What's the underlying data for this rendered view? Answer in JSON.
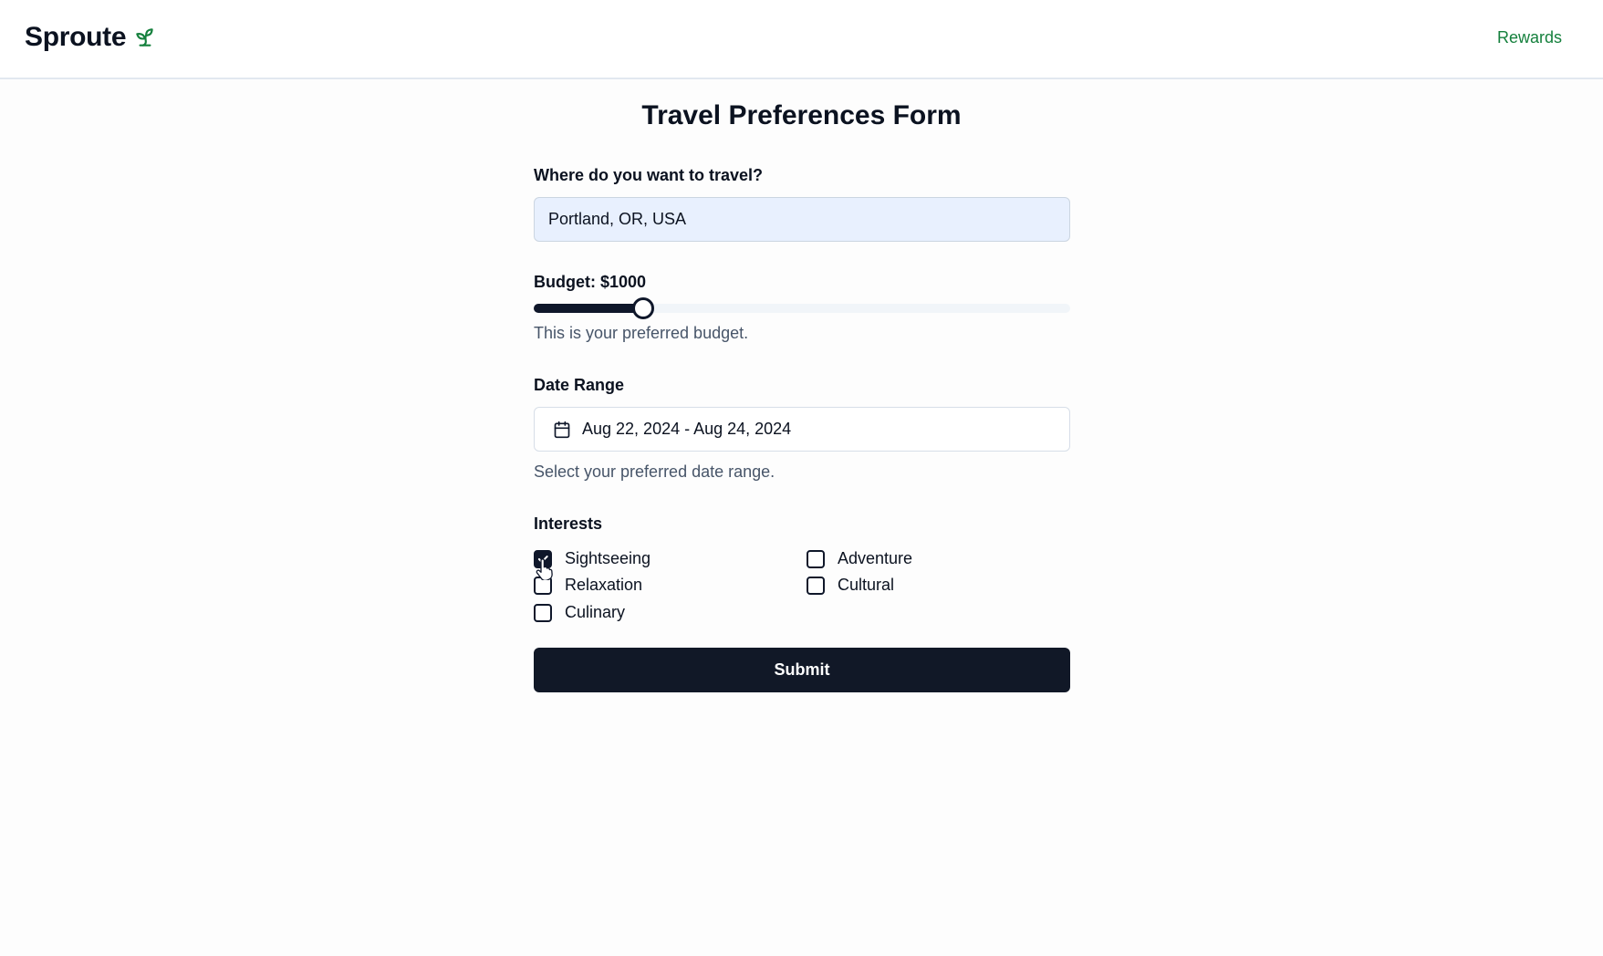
{
  "header": {
    "brand_name": "Sproute",
    "brand_icon": "sprout-icon",
    "nav_link": "Rewards",
    "accent_color": "#15803d"
  },
  "form": {
    "title": "Travel Preferences Form",
    "destination": {
      "label": "Where do you want to travel?",
      "value": "Portland, OR, USA"
    },
    "budget": {
      "label": "Budget: $1000",
      "fraction": 0.204,
      "helper": "This is your preferred budget."
    },
    "date_range": {
      "label": "Date Range",
      "value": "Aug 22, 2024 - Aug 24, 2024",
      "icon": "calendar-icon",
      "helper": "Select your preferred date range."
    },
    "interests": {
      "label": "Interests",
      "options": [
        {
          "label": "Sightseeing",
          "checked": true
        },
        {
          "label": "Adventure",
          "checked": false
        },
        {
          "label": "Relaxation",
          "checked": false
        },
        {
          "label": "Cultural",
          "checked": false
        },
        {
          "label": "Culinary",
          "checked": false
        }
      ]
    },
    "submit_label": "Submit"
  }
}
